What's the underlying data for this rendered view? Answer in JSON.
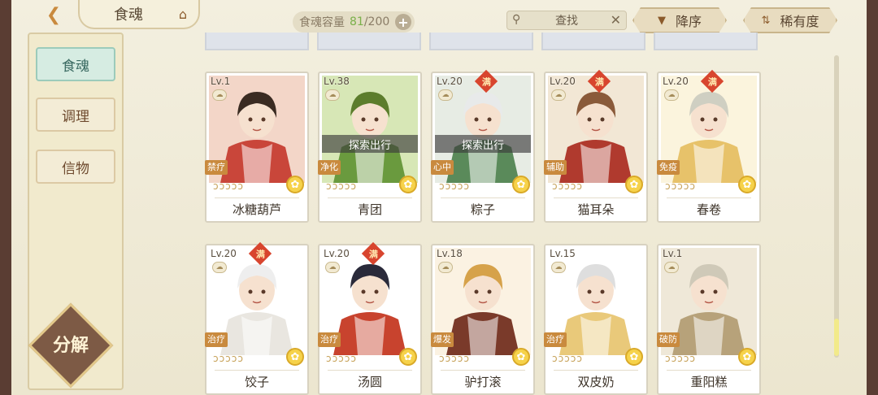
{
  "header": {
    "title": "食魂",
    "capacity_label": "食魂容量",
    "capacity_current": "81",
    "capacity_max": "/200",
    "search_label": "查找",
    "sort_order_label": "降序",
    "sort_rarity_label": "稀有度"
  },
  "sidebar": {
    "tabs": [
      {
        "label": "食魂",
        "active": true
      },
      {
        "label": "调理",
        "active": false
      },
      {
        "label": "信物",
        "active": false
      }
    ],
    "decompose_label": "分解"
  },
  "cards": [
    {
      "level": "Lv.1",
      "name": "冰糖葫芦",
      "role": "禁疗",
      "max": false,
      "explore": "",
      "stars": "ↄↄↄↄↄ",
      "color": "#c9463a",
      "accent": "#f3d6c8",
      "hair": "#3a2b22"
    },
    {
      "level": "Lv.38",
      "name": "青团",
      "role": "净化",
      "max": false,
      "explore": "探索出行",
      "stars": "ↄↄↄↄↄ",
      "color": "#6a9a3e",
      "accent": "#d7e7b6",
      "hair": "#5c7d2c"
    },
    {
      "level": "Lv.20",
      "name": "粽子",
      "role": "心中",
      "max": true,
      "explore": "探索出行",
      "stars": "ↄↄↄↄↄ",
      "color": "#5a8a5a",
      "accent": "#e7ece4",
      "hair": "#e8eaea"
    },
    {
      "level": "Lv.20",
      "name": "猫耳朵",
      "role": "辅助",
      "max": true,
      "explore": "",
      "stars": "ↄↄↄↄↄ",
      "color": "#b03a2e",
      "accent": "#f2e7d5",
      "hair": "#8a5a3a"
    },
    {
      "level": "Lv.20",
      "name": "春卷",
      "role": "免疫",
      "max": true,
      "explore": "",
      "stars": "ↄↄↄↄↄ",
      "color": "#e7c26a",
      "accent": "#fbf4dd",
      "hair": "#cfcfc2"
    },
    {
      "level": "Lv.20",
      "name": "饺子",
      "role": "治疗",
      "max": true,
      "explore": "",
      "stars": "ↄↄↄↄↄ",
      "color": "#e9e6e0",
      "accent": "#ffffff",
      "hair": "#eeeeee"
    },
    {
      "level": "Lv.20",
      "name": "汤圆",
      "role": "治疗",
      "max": true,
      "explore": "",
      "stars": "ↄↄↄↄↄ",
      "color": "#c8432e",
      "accent": "#ffffff",
      "hair": "#2a2a3a"
    },
    {
      "level": "Lv.18",
      "name": "驴打滚",
      "role": "爆发",
      "max": false,
      "explore": "",
      "stars": "ↄↄↄↄↄ",
      "color": "#7a3a2a",
      "accent": "#fbf2e2",
      "hair": "#d6a24a"
    },
    {
      "level": "Lv.15",
      "name": "双皮奶",
      "role": "治疗",
      "max": false,
      "explore": "",
      "stars": "ↄↄↄↄↄ",
      "color": "#e9c97a",
      "accent": "#ffffff",
      "hair": "#dedede"
    },
    {
      "level": "Lv.1",
      "name": "重阳糕",
      "role": "破防",
      "max": false,
      "explore": "",
      "stars": "ↄↄↄↄↄ",
      "color": "#b7a27a",
      "accent": "#efe8d8",
      "hair": "#cfc9b8"
    }
  ],
  "badge_max_label": "满"
}
